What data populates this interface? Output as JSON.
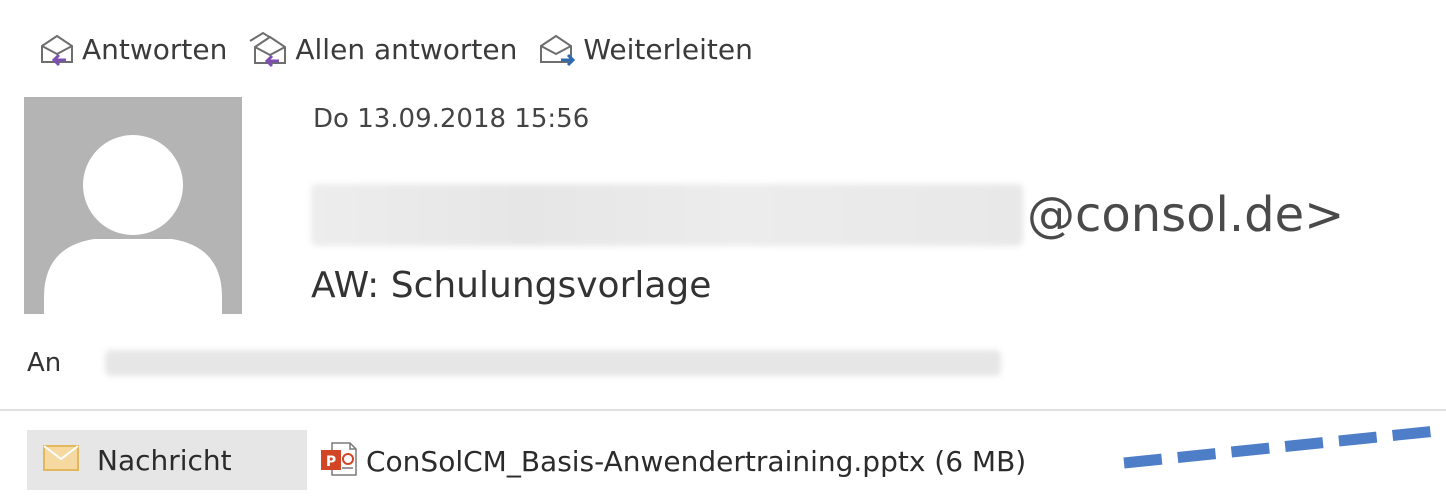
{
  "toolbar": {
    "reply_label": "Antworten",
    "reply_all_label": "Allen antworten",
    "forward_label": "Weiterleiten",
    "icon_color": "#6e6e6e",
    "reply_arrow_color": "#7d4fb0",
    "forward_arrow_color": "#2e6ab0"
  },
  "header": {
    "date": "Do 13.09.2018 15:56",
    "sender_visible": "@consol.de>",
    "subject": "AW: Schulungsvorlage",
    "to_label": "An",
    "avatar_icon": "person-placeholder-icon"
  },
  "attachments": {
    "message_label": "Nachricht",
    "message_icon": "envelope-icon",
    "file_name": "ConSolCM_Basis-Anwendertraining.pptx (6 MB)",
    "file_icon": "powerpoint-file-icon",
    "annotation_color": "#4f7ec8"
  }
}
